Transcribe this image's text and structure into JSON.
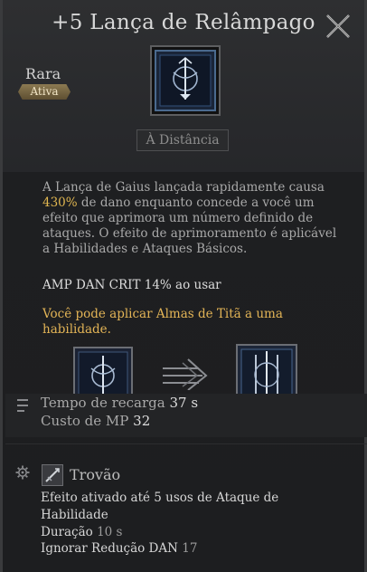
{
  "header": {
    "title": "+5 Lança de Relâmpago",
    "rarity": "Rara",
    "type_badge": "Ativa",
    "range_tag": "À Distância",
    "close_icon": "close-icon"
  },
  "description": {
    "line_pre": "A Lança de Gaius lançada rapidamente causa ",
    "damage_percent": "430%",
    "line_post": " de dano enquanto concede a você um efeito que aprimora um número definido de ataques. O efeito de aprimoramento é aplicável a Habilidades e Ataques Básicos.",
    "amp_text": "AMP DAN CRIT 14% ao usar",
    "titan_soul_text": "Você pode aplicar Almas de Titã a uma habilidade."
  },
  "stats": {
    "cooldown_label": "Tempo de recarga",
    "cooldown_value": "37 s",
    "mp_label": "Custo de MP",
    "mp_value": "32"
  },
  "rune": {
    "name": "Trovão",
    "effect_line1": "Efeito ativado até 5 usos de Ataque de",
    "effect_line2": "Habilidade",
    "duration_label": "Duração",
    "duration_value": "10 s",
    "ignore_label": "Ignorar Redução DAN",
    "ignore_value": "17"
  },
  "colors": {
    "highlight": "#e0b650",
    "badge": "#8c7a52",
    "background": "#1f2022"
  }
}
